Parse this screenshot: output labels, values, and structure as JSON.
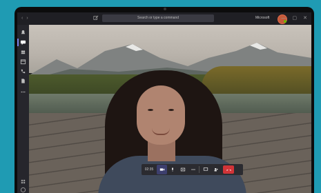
{
  "titlebar": {
    "search_placeholder": "Search or type a command",
    "org_name": "Microsoft",
    "nav_back": "‹",
    "nav_forward": "›"
  },
  "window_controls": {
    "minimize": "—",
    "maximize": "▢",
    "close": "✕"
  },
  "rail": {
    "items": [
      {
        "name": "activity"
      },
      {
        "name": "chat"
      },
      {
        "name": "teams"
      },
      {
        "name": "calendar"
      },
      {
        "name": "calls"
      },
      {
        "name": "files"
      },
      {
        "name": "more"
      }
    ],
    "active_index": 1
  },
  "call_toolbar": {
    "timer": "02:35"
  },
  "colors": {
    "accent": "#7b83eb",
    "hangup": "#d13438",
    "background": "#1f9bb3"
  }
}
